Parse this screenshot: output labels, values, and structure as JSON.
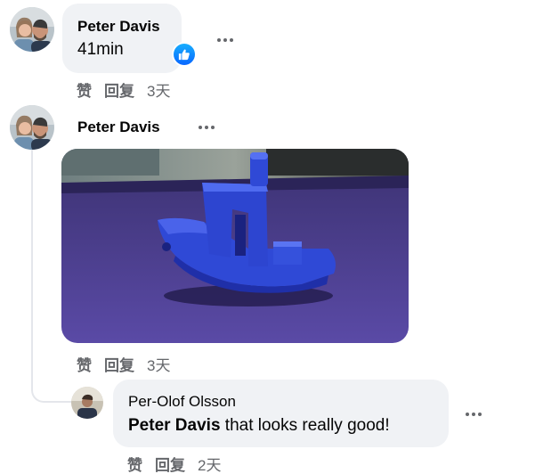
{
  "comments": [
    {
      "author": "Peter Davis",
      "text": "41min",
      "actions": {
        "like": "赞",
        "reply": "回复",
        "time": "3天"
      },
      "reaction_icon": "thumbs-up-icon"
    },
    {
      "author": "Peter Davis",
      "photo_icon": "3d-printed-boat-photo",
      "actions": {
        "like": "赞",
        "reply": "回复",
        "time": "3天"
      }
    },
    {
      "author": "Per-Olof Olsson",
      "mention": "Peter Davis",
      "text": " that looks really good!",
      "actions": {
        "like": "赞",
        "reply": "回复",
        "time": "2天"
      }
    }
  ],
  "colors": {
    "bubble": "#f0f2f5",
    "secondary_text": "#65676b",
    "like_blue": "#0866ff",
    "boat_blue": "#2f49d6",
    "mat_purple": "#4d3f8f"
  }
}
